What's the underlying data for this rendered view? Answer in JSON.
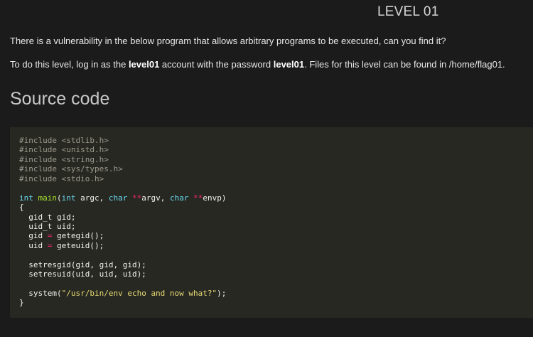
{
  "page": {
    "title": "LEVEL 01",
    "intro": "There is a vulnerability in the below program that allows arbitrary programs to be executed, can you find it?",
    "login": {
      "prefix": "To do this level, log in as the ",
      "account": "level01",
      "middle": " account with the password ",
      "password": "level01",
      "suffix": ". Files for this level can be found in /home/flag01."
    },
    "section_heading": "Source code"
  },
  "source_code": {
    "includes": [
      "#include <stdlib.h>",
      "#include <unistd.h>",
      "#include <string.h>",
      "#include <sys/types.h>",
      "#include <stdio.h>"
    ],
    "main_sig": {
      "ret_type": "int",
      "name": "main",
      "open": "(",
      "arg1_type": "int",
      "arg1_name": " argc, ",
      "arg2_type": "char",
      "arg2_ptr": " **",
      "arg2_name": "argv, ",
      "arg3_type": "char",
      "arg3_ptr": " **",
      "arg3_name": "envp)"
    },
    "open_brace": "{",
    "decl1": "  gid_t gid;",
    "decl2": "  uid_t uid;",
    "assign1": {
      "lhs": "  gid ",
      "op": "=",
      "rhs": " getegid();"
    },
    "assign2": {
      "lhs": "  uid ",
      "op": "=",
      "rhs": " geteuid();"
    },
    "call1": "  setresgid(gid, gid, gid);",
    "call2": "  setresuid(uid, uid, uid);",
    "system_call": {
      "prefix": "  system(",
      "arg": "\"/usr/bin/env echo and now what?\"",
      "suffix": ");"
    },
    "close_brace": "}"
  },
  "colors": {
    "background": "#1b1b1b",
    "code_background": "#282822",
    "keyword": "#66d9ef",
    "function": "#a6e22e",
    "operator": "#f92672",
    "string": "#e6db74",
    "comment": "#9a9a8f"
  }
}
